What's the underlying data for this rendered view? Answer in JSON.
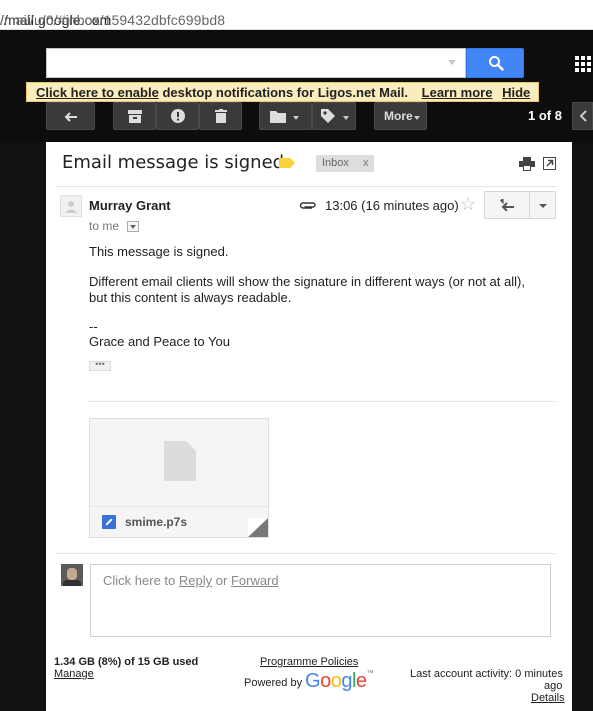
{
  "browser": {
    "url_host": "//mail.google.com",
    "url_path": "/mail/u/0/#inbox/159432dbfc699bd8"
  },
  "notification": {
    "enable_link": "Click here to enable",
    "message": "desktop notifications for Ligos.net Mail.",
    "learn_more": "Learn more",
    "hide": "Hide"
  },
  "toolbar": {
    "more_label": "More",
    "pager": "1 of 8"
  },
  "email": {
    "subject": "Email message is signed",
    "label": "Inbox",
    "label_remove": "x",
    "sender": "Murray Grant",
    "to": "to me",
    "time": "13:06 (16 minutes ago)",
    "body": [
      "This message is signed.",
      "Different email clients will show the signature in different ways (or not at all),",
      "but this content is always readable.",
      "--",
      "Grace and Peace to You"
    ],
    "ellipsis": "•••",
    "attachment_name": "smime.p7s"
  },
  "reply": {
    "prefix": "Click here to",
    "reply": "Reply",
    "or": "or",
    "forward": "Forward"
  },
  "footer": {
    "storage": "1.34 GB (8%) of 15 GB used",
    "manage": "Manage",
    "policies": "Programme Policies",
    "powered_by": "Powered by",
    "google_letters": [
      "G",
      "o",
      "o",
      "g",
      "l",
      "e"
    ],
    "tm": "™",
    "last_activity": "Last account activity: 0 minutes",
    "ago": "ago",
    "details": "Details"
  },
  "colors": {
    "search_blue": "#4285f4",
    "label_yellow": "#f9d33b",
    "notify_bg": "#f9edbe",
    "google": [
      "#4285f4",
      "#ea4335",
      "#fbbc05",
      "#4285f4",
      "#34a853",
      "#ea4335"
    ]
  },
  "icons": [
    "search-icon",
    "apps-icon",
    "back-arrow-icon",
    "archive-icon",
    "report-spam-icon",
    "delete-icon",
    "folder-icon",
    "tag-icon",
    "print-icon",
    "popout-icon",
    "paperclip-icon",
    "star-icon",
    "reply-icon",
    "file-icon"
  ]
}
